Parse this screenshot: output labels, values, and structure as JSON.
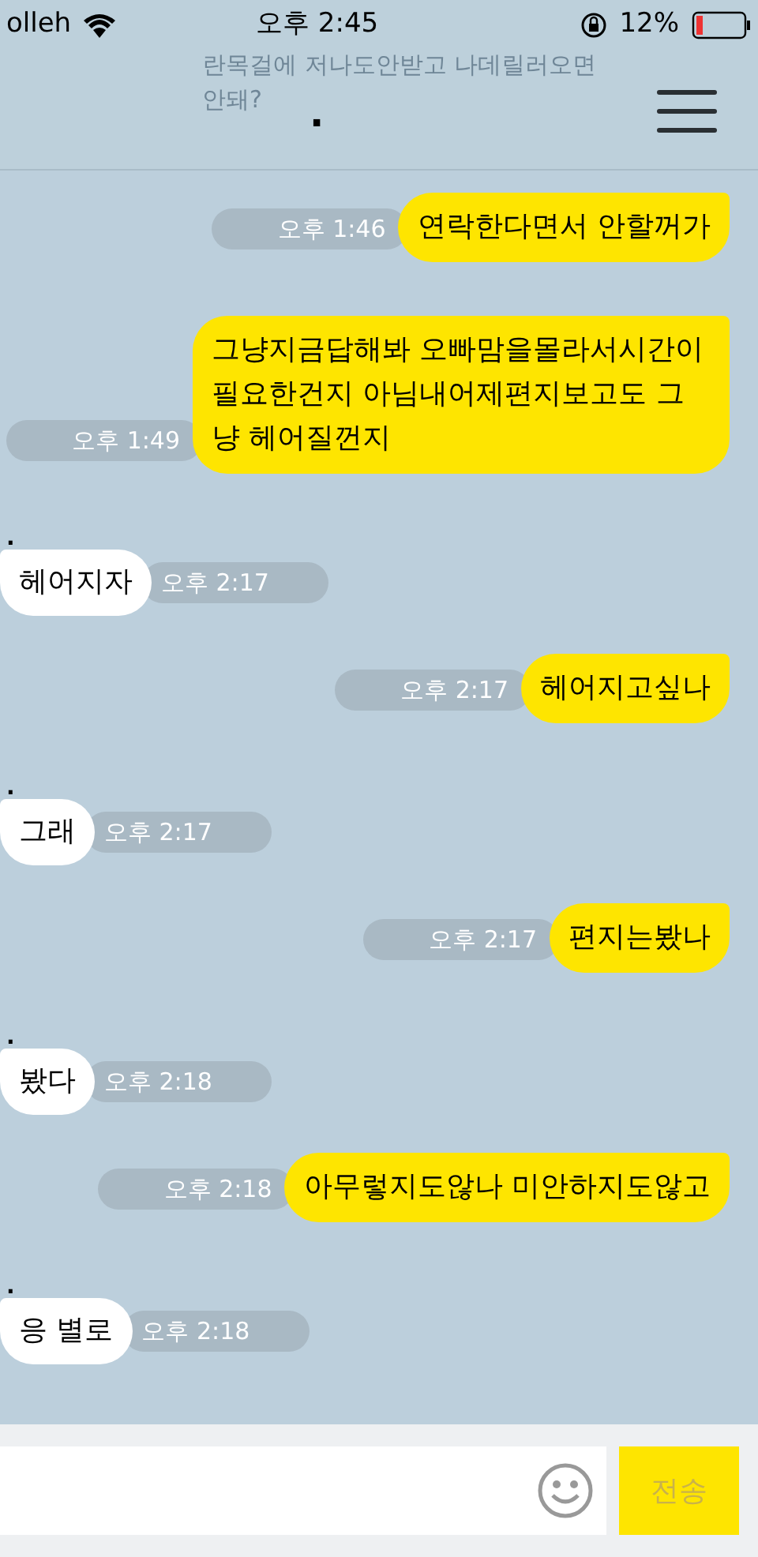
{
  "status_bar": {
    "carrier": "olleh",
    "time": "오후 2:45",
    "battery": "12%"
  },
  "notification": {
    "lines": [
      "란목걸에 저나도안받고 나데릴러오면",
      "안돼?"
    ]
  },
  "header": {
    "title": "."
  },
  "messages": [
    {
      "kind": "sent",
      "text": "연락한다면서 안할꺼가",
      "time": "오후 1:46"
    },
    {
      "kind": "sent",
      "text": "그냥지금답해봐 오빠맘을몰라서시간이 필요한건지 아님내어제편지보고도 그냥 헤어질껀지",
      "time": "오후 1:49"
    },
    {
      "kind": "received",
      "sender": ".",
      "text": "헤어지자",
      "time": "오후 2:17"
    },
    {
      "kind": "sent",
      "text": "헤어지고싶나",
      "time": "오후 2:17"
    },
    {
      "kind": "received",
      "sender": ".",
      "text": "그래",
      "time": "오후 2:17"
    },
    {
      "kind": "sent",
      "text": "편지는봤나",
      "time": "오후 2:17"
    },
    {
      "kind": "received",
      "sender": ".",
      "text": "봤다",
      "time": "오후 2:18"
    },
    {
      "kind": "sent",
      "text": "아무렇지도않나 미안하지도않고",
      "time": "오후 2:18"
    },
    {
      "kind": "received",
      "sender": ".",
      "text": "응 별로",
      "time": "오후 2:18"
    }
  ],
  "composer": {
    "send_label": "전송"
  }
}
